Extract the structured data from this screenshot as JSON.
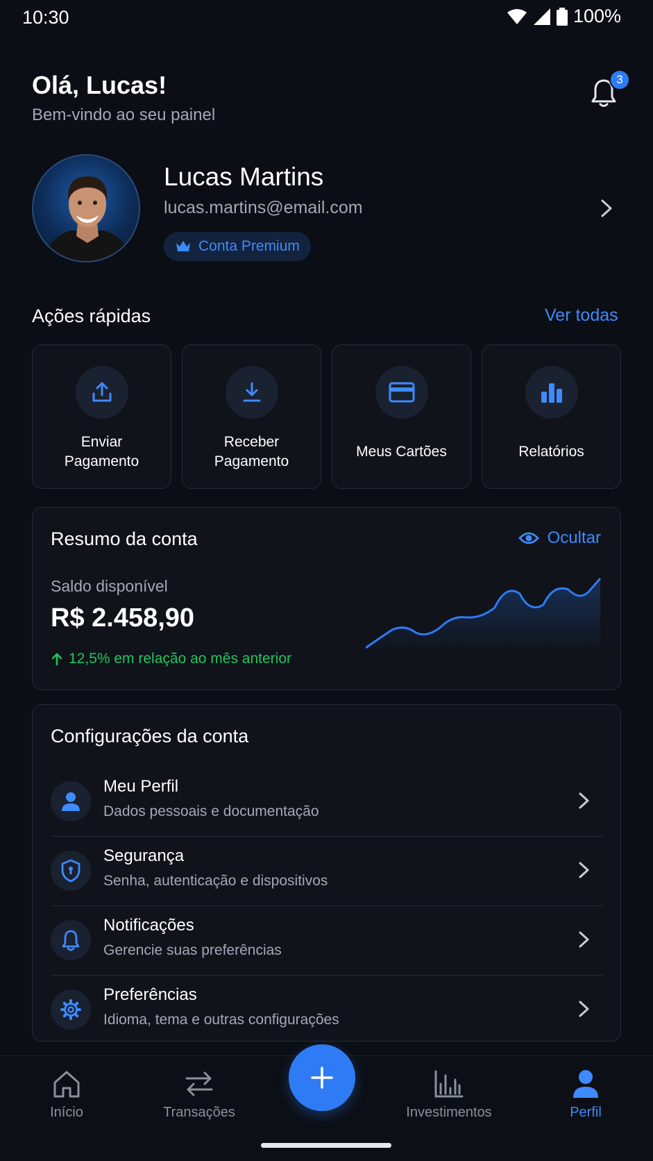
{
  "status_bar": {
    "time": "10:30",
    "battery": "100%"
  },
  "header": {
    "greeting": "Olá, Lucas!",
    "subtitle": "Bem-vindo ao seu painel",
    "notification_count": "3"
  },
  "profile": {
    "name": "Lucas Martins",
    "email": "lucas.martins@email.com",
    "badge": "Conta Premium"
  },
  "quick_actions": {
    "title": "Ações rápidas",
    "see_all": "Ver todas",
    "items": [
      {
        "line1": "Enviar",
        "line2": "Pagamento",
        "icon": "upload-icon"
      },
      {
        "line1": "Receber",
        "line2": "Pagamento",
        "icon": "download-icon"
      },
      {
        "label": "Meus Cartões",
        "icon": "card-icon"
      },
      {
        "label": "Relatórios",
        "icon": "bar-chart-icon"
      }
    ]
  },
  "summary": {
    "title": "Resumo da conta",
    "hide_label": "Ocultar",
    "balance_label": "Saldo disponível",
    "balance_value": "R$ 2.458,90",
    "change_text": "12,5% em relação ao mês anterior"
  },
  "settings": {
    "title": "Configurações da conta",
    "items": [
      {
        "label": "Meu Perfil",
        "desc": "Dados pessoais e documentação",
        "icon": "user-icon"
      },
      {
        "label": "Segurança",
        "desc": "Senha, autenticação e dispositivos",
        "icon": "shield-icon"
      },
      {
        "label": "Notificações",
        "desc": "Gerencie suas preferências",
        "icon": "bell-icon"
      },
      {
        "label": "Preferências",
        "desc": "Idioma, tema e outras configurações",
        "icon": "gear-icon"
      }
    ]
  },
  "bottom_nav": {
    "items": [
      {
        "label": "Início",
        "icon": "home-icon"
      },
      {
        "label": "Transações",
        "icon": "transfer-icon"
      },
      {
        "label": "Investimentos",
        "icon": "investments-icon"
      },
      {
        "label": "Perfil",
        "icon": "profile-icon"
      }
    ],
    "active": "Perfil"
  },
  "colors": {
    "accent": "#2f7bf5",
    "link": "#3d8bff",
    "positive": "#22c55e",
    "background": "#0b0e14",
    "card": "#10131a"
  }
}
